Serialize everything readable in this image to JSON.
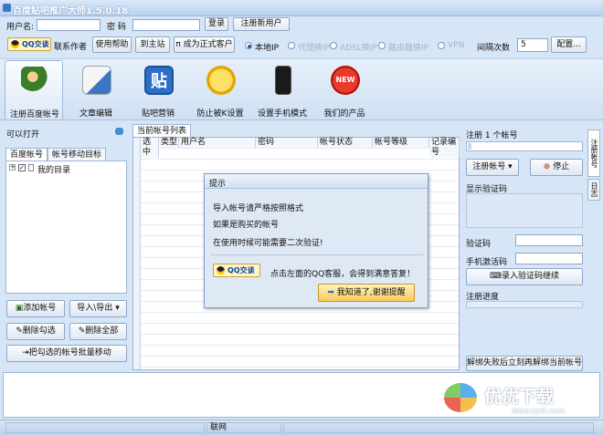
{
  "window": {
    "title": "百度贴吧推广大师1.5.0.18"
  },
  "login": {
    "user_label": "用户名:",
    "user_value": "",
    "pass_label": "密 码",
    "login_btn": "登录",
    "register_btn": "注册新用户"
  },
  "toolbar": {
    "qq_label": "QQ交谈",
    "contact_label": "联系作者",
    "help_label": "使用帮助",
    "site_label": "到主站",
    "upgrade_label": "π 成为正式客户",
    "net_options": [
      {
        "label": "本地IP",
        "selected": true
      },
      {
        "label": "代理换IP",
        "selected": false
      },
      {
        "label": "ADSL换IP",
        "selected": false
      },
      {
        "label": "路由器换IP",
        "selected": false
      },
      {
        "label": "VPN",
        "selected": false
      }
    ],
    "interval_label": "间隔次数",
    "interval_value": "5",
    "config_label": "配置..."
  },
  "bigbar": [
    {
      "label": "注册百度帐号",
      "icon": "user-register-icon",
      "active": true
    },
    {
      "label": "文章编辑",
      "icon": "article-edit-icon",
      "active": false
    },
    {
      "label": "贴吧营销",
      "icon": "tieba-post-icon",
      "active": false
    },
    {
      "label": "防止被K设置",
      "icon": "wrench-icon",
      "active": false
    },
    {
      "label": "设置手机模式",
      "icon": "phone-icon",
      "active": false
    },
    {
      "label": "我们的产品",
      "icon": "new-badge-icon",
      "active": false
    }
  ],
  "left": {
    "open_label": "可以打开",
    "tabs": [
      "百度帐号",
      "帐号移动目标"
    ],
    "tree_item": "我的目录",
    "buttons": {
      "add": "添加帐号",
      "import_export": "导入\\导出",
      "del_checked": "删除勾选",
      "del_all": "删除全部",
      "move": "把勾选的帐号批量移动"
    }
  },
  "center": {
    "tab": "当前帐号列表",
    "columns": [
      "选中",
      "类型",
      "用户名",
      "密码",
      "帐号状态",
      "帐号等级",
      "记录编号"
    ]
  },
  "dialog": {
    "title": "提示",
    "line1": "导入帐号请严格按照格式",
    "line2": "如果是购买的帐号",
    "line3": "在使用时候可能需要二次验证!",
    "qq_label": "QQ交谈",
    "qq_text": "点击左面的QQ客服，会得到满意答复！",
    "ok_btn": "我知道了,谢谢提醒"
  },
  "right": {
    "register_label": "注册 1 个帐号",
    "register_btn": "注册帐号",
    "stop_btn": "停止",
    "show_code": "显示验证码",
    "code_label": "验证码",
    "sms_label": "手机激活码",
    "enter_code": "录入验证码继续",
    "progress_label": "注册进度",
    "unbind_btn": "解绑失败后立刻再解绑当前帐号",
    "side_tabs": [
      "注册帐号",
      "日志"
    ]
  },
  "statusbar": {
    "net": "联网"
  },
  "watermark": {
    "text": "优优下载",
    "url": "www.yyxt.com"
  }
}
